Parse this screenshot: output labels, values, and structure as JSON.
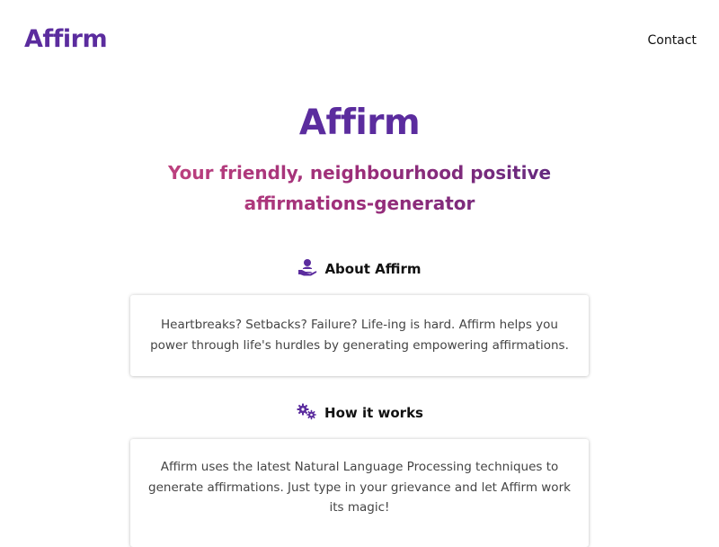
{
  "navbar": {
    "brand": "Affirm",
    "contact_label": "Contact"
  },
  "hero": {
    "title": "Affirm",
    "subtitle": "Your friendly, neighbourhood positive affirmations-generator"
  },
  "sections": [
    {
      "icon": "hand-holding-person-icon",
      "heading": "About Affirm",
      "body": "Heartbreaks? Setbacks? Failure? Life-ing is hard. Affirm helps you power through life's hurdles by generating empowering affirmations."
    },
    {
      "icon": "gears-icon",
      "heading": "How it works",
      "body": "Affirm uses the latest Natural Language Processing techniques to generate affirmations. Just type in your grievance and let Affirm work its magic!"
    }
  ],
  "colors": {
    "brand_purple": "#5b2c9e",
    "subtitle_gradient_start": "#c2447f",
    "subtitle_gradient_end": "#5a2880"
  }
}
